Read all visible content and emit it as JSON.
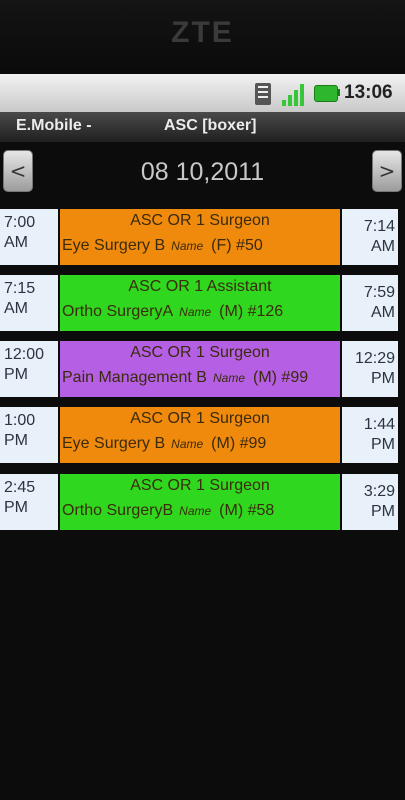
{
  "device": {
    "brand": "ZTE"
  },
  "status_bar": {
    "time": "13:06",
    "icons": [
      "phone-icon",
      "signal-icon",
      "battery-icon"
    ]
  },
  "title_bar": {
    "app_name": "E.Mobile -",
    "screen_title": "ASC [boxer]"
  },
  "date_nav": {
    "prev_label": "<",
    "next_label": ">",
    "date": "08 10,2011"
  },
  "colors": {
    "orange": "#ef8a0c",
    "green": "#2fd81e",
    "purple": "#b45fe4",
    "time_cell": "#e8f0f9"
  },
  "appointments": [
    {
      "start_time": "7:00",
      "start_period": "AM",
      "end_time": "7:14",
      "end_period": "AM",
      "title": "ASC OR 1  Surgeon",
      "procedure": "Eye Surgery B",
      "name_label": "Name",
      "patient": "(F) #50",
      "color": "#ef8a0c"
    },
    {
      "start_time": "7:15",
      "start_period": "AM",
      "end_time": "7:59",
      "end_period": "AM",
      "title": "ASC OR 1  Assistant",
      "procedure": "Ortho SurgeryA",
      "name_label": "Name",
      "patient": "(M) #126",
      "color": "#2fd81e"
    },
    {
      "start_time": "12:00",
      "start_period": "PM",
      "end_time": "12:29",
      "end_period": "PM",
      "title": "ASC OR 1  Surgeon",
      "procedure": "Pain Management B",
      "name_label": "Name",
      "patient": "(M) #99",
      "color": "#b45fe4"
    },
    {
      "start_time": "1:00",
      "start_period": "PM",
      "end_time": "1:44",
      "end_period": "PM",
      "title": "ASC OR 1  Surgeon",
      "procedure": "Eye Surgery B",
      "name_label": "Name",
      "patient": "(M) #99",
      "color": "#ef8a0c"
    },
    {
      "start_time": "2:45",
      "start_period": "PM",
      "end_time": "3:29",
      "end_period": "PM",
      "title": "ASC OR 1  Surgeon",
      "procedure": "Ortho SurgeryB",
      "name_label": "Name",
      "patient": "(M) #58",
      "color": "#2fd81e"
    }
  ]
}
